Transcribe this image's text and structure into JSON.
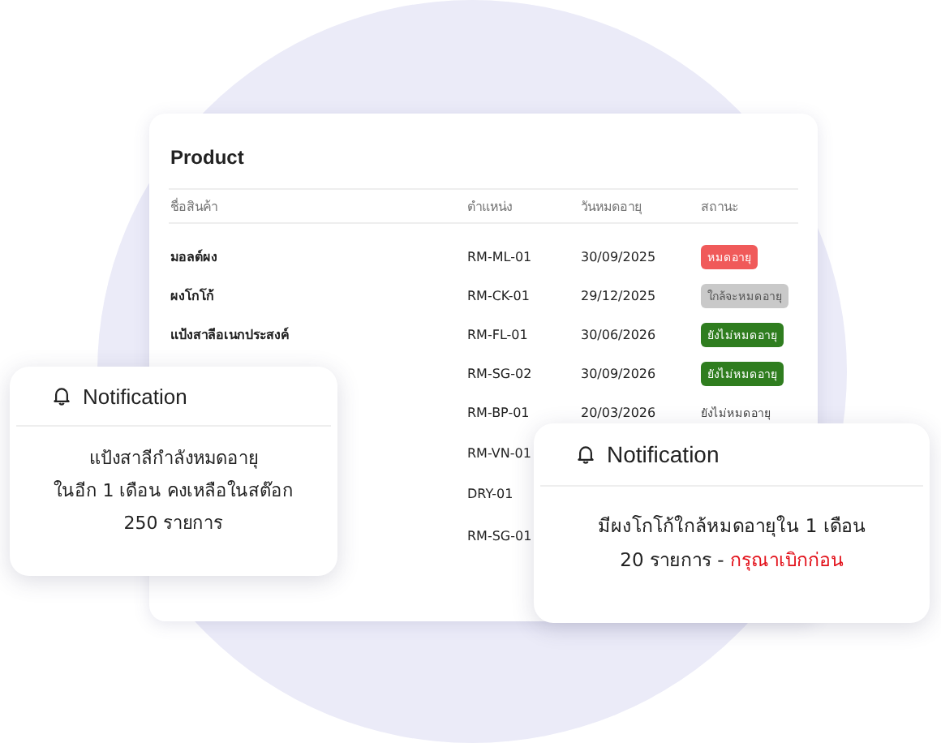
{
  "table": {
    "title": "Product",
    "columns": [
      "ชื่อสินค้า",
      "ตำแหน่ง",
      "วันหมดอายุ",
      "สถานะ"
    ],
    "rows": [
      {
        "name": "มอลต์ผง",
        "location": "RM-ML-01",
        "expiry": "30/09/2025",
        "status": {
          "text": "หมดอายุ",
          "kind": "badge",
          "color": "#f05a5a"
        }
      },
      {
        "name": "ผงโกโก้",
        "location": "RM-CK-01",
        "expiry": "29/12/2025",
        "status": {
          "text": "ใกล้จะหมดอายุ",
          "kind": "badge",
          "color": "#c9c9c9"
        }
      },
      {
        "name": "แป้งสาลีอเนกประสงค์",
        "location": "RM-FL-01",
        "expiry": "30/06/2026",
        "status": {
          "text": "ยังไม่หมดอายุ",
          "kind": "badge",
          "color": "#2f7d1f"
        }
      },
      {
        "location": "RM-SG-02",
        "expiry": "30/09/2026",
        "status": {
          "text": "ยังไม่หมดอายุ",
          "kind": "badge",
          "color": "#2f7d1f"
        }
      },
      {
        "location": "RM-BP-01",
        "expiry": "20/03/2026",
        "status": {
          "text": "ยังไม่หมดอายุ",
          "kind": "text"
        }
      },
      {
        "location": "RM-VN-01"
      },
      {
        "location": "DRY-01"
      },
      {
        "location": "RM-SG-01"
      }
    ]
  },
  "notifications": [
    {
      "title": "Notification",
      "lines": [
        [
          {
            "text": "แป้งสาลีกำลังหมดอายุ",
            "kind": "normal"
          }
        ],
        [
          {
            "text": "ในอีก 1 เดือน คงเหลือในสต๊อก",
            "kind": "normal"
          }
        ],
        [
          {
            "text": "250 รายการ",
            "kind": "normal"
          }
        ]
      ]
    },
    {
      "title": "Notification",
      "lines": [
        [
          {
            "text": "มีผงโกโก้ใกล้หมดอายุใน 1 เดือน",
            "kind": "normal"
          }
        ],
        [
          {
            "text": "20 รายการ - ",
            "kind": "normal"
          },
          {
            "text": "กรุณาเบิกก่อน",
            "kind": "alert"
          }
        ]
      ]
    }
  ]
}
